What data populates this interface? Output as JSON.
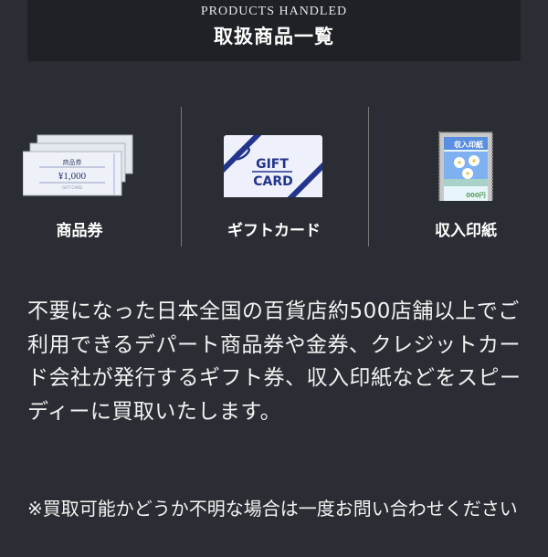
{
  "header": {
    "subtitle": "PRODUCTS HANDLED",
    "title": "取扱商品一覧"
  },
  "products": [
    {
      "label": "商品券",
      "icon": "gift-voucher-icon",
      "voucher_title": "商品券",
      "voucher_amount": "¥1,000",
      "voucher_sub": "GIFT CARD"
    },
    {
      "label": "ギフトカード",
      "icon": "gift-card-icon",
      "card_line1": "GIFT",
      "card_line2": "CARD"
    },
    {
      "label": "収入印紙",
      "icon": "revenue-stamp-icon",
      "stamp_title": "収入印紙",
      "stamp_value": "000円"
    }
  ],
  "description": "不要になった日本全国の百貨店約500店舗以上でご利用できるデパート商品券や金券、クレジットカード会社が発行するギフト券、収入印紙などをスピーディーに買取いたします。",
  "note": "※買取可能かどうか不明な場合は一度お問い合わせください",
  "colors": {
    "background": "#2a2d33",
    "header_bg": "#1f2126",
    "card_blue": "#22348c"
  }
}
